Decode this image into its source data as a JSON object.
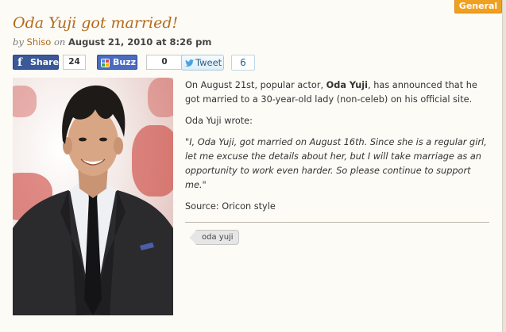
{
  "category": {
    "label": "General"
  },
  "post": {
    "title": "Oda Yuji got married!",
    "byline": {
      "by": "by",
      "author": "Shiso",
      "on": "on",
      "date": "August 21, 2010 at 8:26 pm"
    },
    "share": {
      "facebook": {
        "label": "Share",
        "count": "24"
      },
      "buzz": {
        "label": "Buzz",
        "count": "0"
      },
      "tweet": {
        "label": "Tweet",
        "count": "6"
      }
    },
    "body": {
      "p1_pre": "On August 21st, popular actor, ",
      "p1_name": "Oda Yuji",
      "p1_post": ", has announced that he got married to a 30-year-old lady (non-celeb) on his official site.",
      "p2": "Oda Yuji wrote:",
      "quote": "\"I, Oda Yuji, got married on August 16th.  Since she is a regular girl, let me excuse the details about her, but I will take marriage as an opportunity to work even harder.  So please continue to support me.\"",
      "source": "Source: Oricon style"
    },
    "tags": [
      "oda yuji"
    ]
  },
  "colors": {
    "accent": "#b36a1a",
    "badge": "#f0a020",
    "facebook": "#3b5998",
    "buzz": "#4a6bc0",
    "twitter_text": "#2a5f8a"
  },
  "icons": {
    "facebook": "facebook-f-icon",
    "buzz": "google-buzz-icon",
    "tweet": "twitter-bird-icon",
    "tag": "tag-icon"
  }
}
